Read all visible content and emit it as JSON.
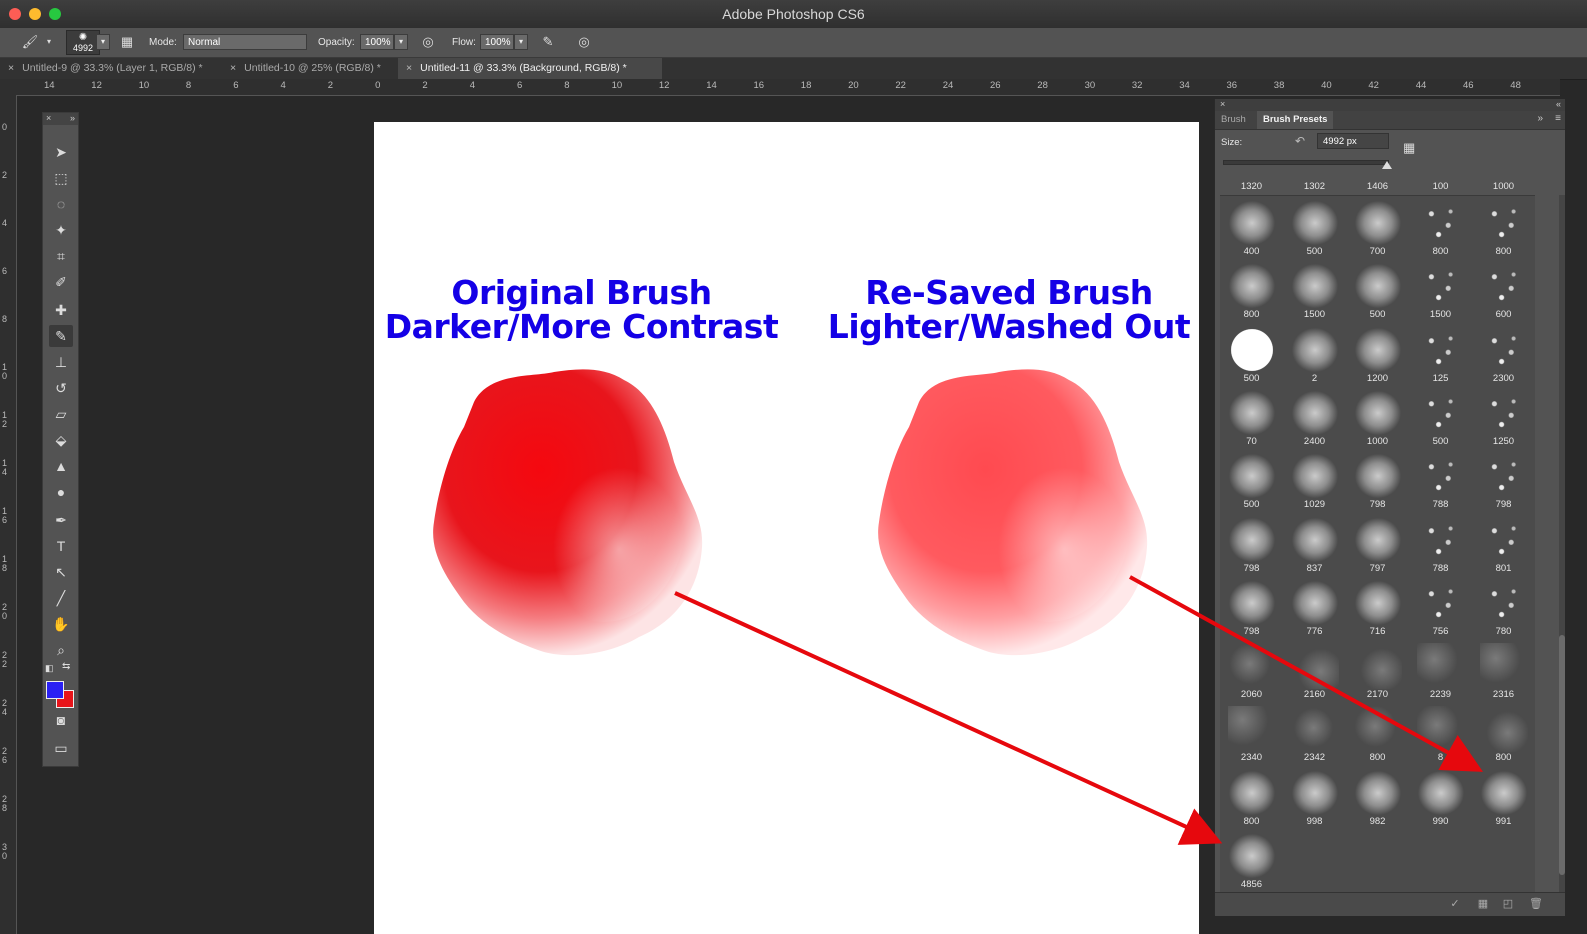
{
  "app": {
    "title": "Adobe Photoshop CS6"
  },
  "options_bar": {
    "brush_size": "4992",
    "mode_label": "Mode:",
    "mode_value": "Normal",
    "opacity_label": "Opacity:",
    "opacity_value": "100%",
    "flow_label": "Flow:",
    "flow_value": "100%"
  },
  "tabs": [
    {
      "label": "Untitled-9 @ 33.3% (Layer 1, RGB/8) *"
    },
    {
      "label": "Untitled-10 @ 25% (RGB/8) *"
    },
    {
      "label": "Untitled-11 @ 33.3% (Background, RGB/8) *"
    }
  ],
  "tab_close": "×",
  "ruler_h": [
    "14",
    "12",
    "10",
    "8",
    "6",
    "4",
    "2",
    "0",
    "2",
    "4",
    "6",
    "8",
    "10",
    "12",
    "14",
    "16",
    "18",
    "20",
    "22",
    "24",
    "26",
    "28",
    "30",
    "32",
    "34",
    "36",
    "38",
    "40",
    "42",
    "44",
    "46",
    "48"
  ],
  "ruler_v": [
    "0",
    "2",
    "4",
    "6",
    "8",
    "10",
    "12",
    "14",
    "16",
    "18",
    "20",
    "22",
    "24",
    "26",
    "28",
    "30"
  ],
  "canvas": {
    "left_heading": [
      "Original Brush",
      "Darker/More Contrast"
    ],
    "right_heading": [
      "Re-Saved Brush",
      "Lighter/Washed Out"
    ],
    "colors": {
      "heading": "#1400e6",
      "left_blob": "#f20a12",
      "right_blob": "#ff4a50",
      "arrow": "#e6080d"
    }
  },
  "colors": {
    "foreground": "#2a20f4",
    "background": "#e8141a"
  },
  "panel": {
    "tabs": [
      {
        "label": "Brush"
      },
      {
        "label": "Brush Presets"
      }
    ],
    "size_label": "Size:",
    "size_value": "4992 px",
    "top_row_labels": [
      "1320",
      "1302",
      "1406",
      "100",
      "1000"
    ],
    "presets": [
      "400",
      "500",
      "700",
      "800",
      "800",
      "800",
      "1500",
      "500",
      "1500",
      "600",
      "500",
      "2",
      "1200",
      "125",
      "2300",
      "70",
      "2400",
      "1000",
      "500",
      "1250",
      "500",
      "1029",
      "798",
      "788",
      "798",
      "798",
      "837",
      "797",
      "788",
      "801",
      "798",
      "776",
      "716",
      "756",
      "780",
      "2060",
      "2160",
      "2170",
      "2239",
      "2316",
      "2340",
      "2342",
      "800",
      "8",
      "800",
      "800",
      "998",
      "982",
      "990",
      "991",
      "4856"
    ]
  }
}
